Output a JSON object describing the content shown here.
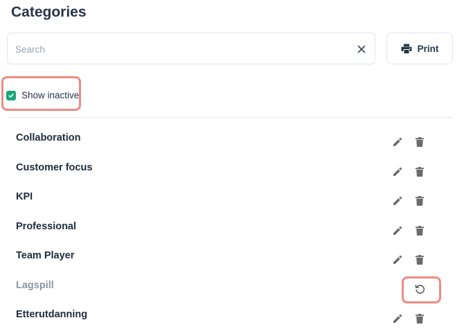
{
  "page": {
    "title": "Categories"
  },
  "search": {
    "placeholder": "Search",
    "value": "",
    "clear_icon": "close-icon"
  },
  "toolbar": {
    "print_label": "Print",
    "print_icon": "printer-icon"
  },
  "filter": {
    "show_inactive_label": "Show inactive",
    "show_inactive_checked": true
  },
  "categories": [
    {
      "name": "Collaboration",
      "active": true
    },
    {
      "name": "Customer focus",
      "active": true
    },
    {
      "name": "KPI",
      "active": true
    },
    {
      "name": "Professional",
      "active": true
    },
    {
      "name": "Team Player",
      "active": true
    },
    {
      "name": "Lagspill",
      "active": false
    },
    {
      "name": "Etterutdanning",
      "active": true
    }
  ],
  "colors": {
    "accent_green": "#1aa775",
    "highlight": "#ee8b82",
    "text_dark": "#1e2a3d",
    "text_inactive": "#8c97a3",
    "icon_gray": "#6b6b6b"
  }
}
